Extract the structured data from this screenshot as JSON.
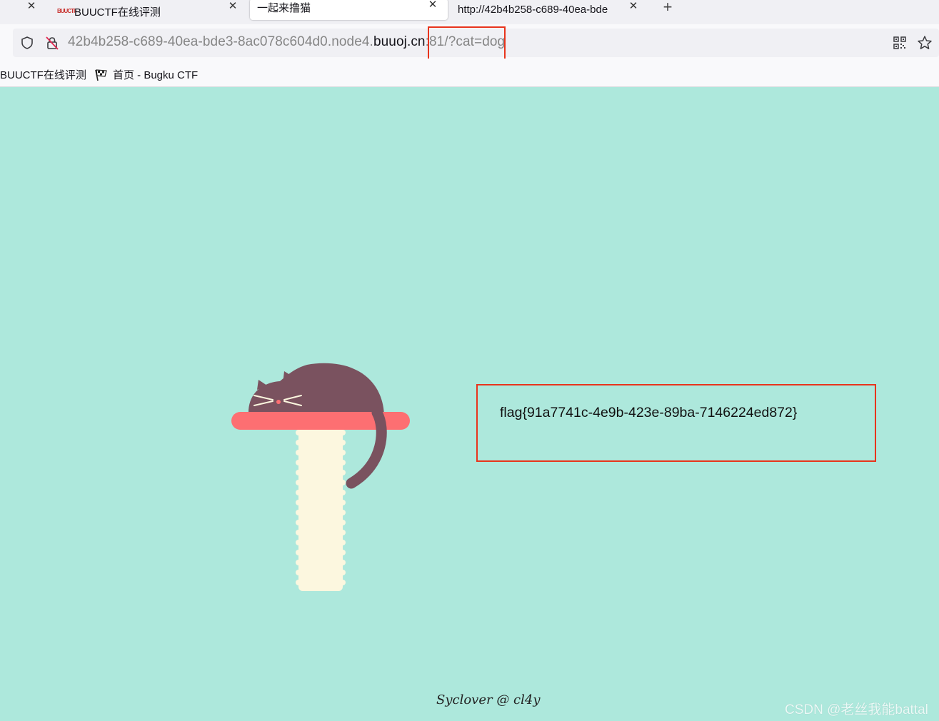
{
  "tabs": [
    {
      "label": "",
      "active": false
    },
    {
      "label": "BUUCTF在线评测",
      "active": false,
      "favicon_text": "BUUCTF"
    },
    {
      "label": "一起来撸猫",
      "active": true
    },
    {
      "label": "http://42b4b258-c689-40ea-bde",
      "active": false
    }
  ],
  "url": {
    "prefix": "42b4b258-c689-40ea-bde3-8ac078c604d0.node4.",
    "domain": "buuoj.cn",
    "port": ":81",
    "query": "/?cat=dog"
  },
  "bookmarks": [
    {
      "label": "BUUCTF在线评测"
    },
    {
      "label": "首页 - Bugku CTF",
      "icon": "flag-icon"
    }
  ],
  "page": {
    "flag": "flag{91a7741c-4e9b-423e-89ba-7146224ed872}",
    "credit": "Syclover @ cl4y"
  },
  "watermark": "CSDN @老丝我能battal",
  "colors": {
    "background": "#ade8dc",
    "cat": "#7a525f",
    "shelf": "#fd6f72",
    "post": "#fcf7df",
    "highlight": "#e8341c"
  }
}
